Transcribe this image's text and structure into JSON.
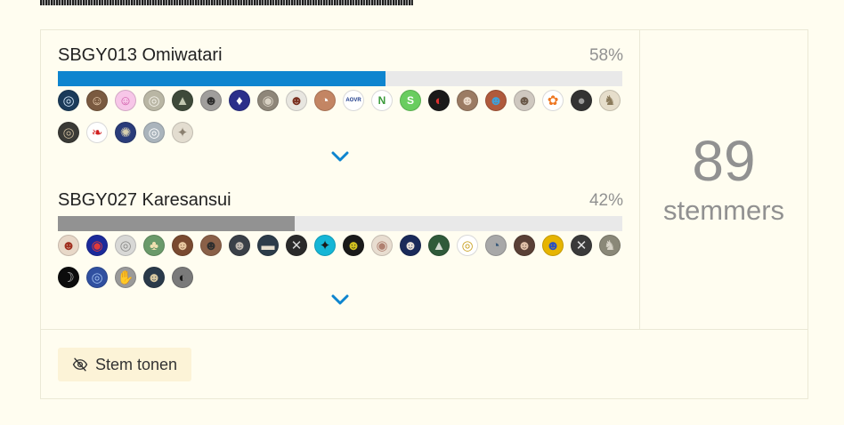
{
  "poll": {
    "options": [
      {
        "name": "SBGY013 Omiwatari",
        "percent_label": "58%",
        "percent": 58,
        "bar_color": "#0e85cf",
        "voters": [
          {
            "bg": "#1b3b5a",
            "fg": "#cfe3f5",
            "glyph": "◎"
          },
          {
            "bg": "#7a5a40",
            "fg": "#f3d8b8",
            "glyph": "☺"
          },
          {
            "bg": "#f7c6e8",
            "fg": "#d05aa8",
            "glyph": "☺"
          },
          {
            "bg": "#b9b6a4",
            "fg": "#f4f2ea",
            "glyph": "◎"
          },
          {
            "bg": "#3e4a3a",
            "fg": "#c0c7b0",
            "glyph": "▲"
          },
          {
            "bg": "#a09e9c",
            "fg": "#2e2e2e",
            "glyph": "☻"
          },
          {
            "bg": "#2b2f8a",
            "fg": "#ffffff",
            "glyph": "♦"
          },
          {
            "bg": "#8e8679",
            "fg": "#d9d2c4",
            "glyph": "◉"
          },
          {
            "bg": "#e8e6e0",
            "fg": "#7a3020",
            "glyph": "☻"
          },
          {
            "bg": "#c38563",
            "fg": "#ffffff",
            "glyph": "◔"
          },
          {
            "bg": "#ffffff",
            "fg": "#1c3a8a",
            "glyph": "AOVR"
          },
          {
            "bg": "#ffffff",
            "fg": "#3a9a3a",
            "glyph": "N"
          },
          {
            "bg": "#69cd5f",
            "fg": "#ffffff",
            "glyph": "S"
          },
          {
            "bg": "#1a1a1a",
            "fg": "#e03030",
            "glyph": "◐"
          },
          {
            "bg": "#9b7b63",
            "fg": "#e9d8c8",
            "glyph": "☻"
          },
          {
            "bg": "#b05a3c",
            "fg": "#3fa0d8",
            "glyph": "☻"
          },
          {
            "bg": "#cfc8c0",
            "fg": "#6a5848",
            "glyph": "☻"
          },
          {
            "bg": "#ffffff",
            "fg": "#ee7722",
            "glyph": "✿"
          },
          {
            "bg": "#333333",
            "fg": "#9a9a9a",
            "glyph": "●"
          },
          {
            "bg": "#e6decb",
            "fg": "#8a7a5a",
            "glyph": "♞"
          },
          {
            "bg": "#3a3a36",
            "fg": "#c8b89a",
            "glyph": "◎"
          },
          {
            "bg": "#ffffff",
            "fg": "#d02020",
            "glyph": "❧"
          },
          {
            "bg": "#2a3c7a",
            "fg": "#d8d0b0",
            "glyph": "✺"
          },
          {
            "bg": "#aab4bc",
            "fg": "#ffffff",
            "glyph": "◎"
          },
          {
            "bg": "#e3ddd0",
            "fg": "#8a8070",
            "glyph": "✦"
          }
        ]
      },
      {
        "name": "SBGY027 Karesansui",
        "percent_label": "42%",
        "percent": 42,
        "bar_color": "#929292",
        "voters": [
          {
            "bg": "#e8d8c8",
            "fg": "#a03020",
            "glyph": "☻"
          },
          {
            "bg": "#1b2a9a",
            "fg": "#e03a3a",
            "glyph": "◉"
          },
          {
            "bg": "#d8d8d6",
            "fg": "#8a8a88",
            "glyph": "◎"
          },
          {
            "bg": "#6a9a6a",
            "fg": "#f0e0b0",
            "glyph": "♣"
          },
          {
            "bg": "#7a4a30",
            "fg": "#e8c8a0",
            "glyph": "☻"
          },
          {
            "bg": "#8a6048",
            "fg": "#2e2e2e",
            "glyph": "☻"
          },
          {
            "bg": "#3a4048",
            "fg": "#c0b8b0",
            "glyph": "☻"
          },
          {
            "bg": "#2c3c4a",
            "fg": "#e8e0d0",
            "glyph": "▬"
          },
          {
            "bg": "#2a2a2a",
            "fg": "#d8d8d8",
            "glyph": "✕"
          },
          {
            "bg": "#15b6d6",
            "fg": "#1a1a1a",
            "glyph": "✦"
          },
          {
            "bg": "#1a1a1a",
            "fg": "#d0c020",
            "glyph": "☻"
          },
          {
            "bg": "#e8ddd0",
            "fg": "#b08070",
            "glyph": "◉"
          },
          {
            "bg": "#1a2a5a",
            "fg": "#e8e0d8",
            "glyph": "☻"
          },
          {
            "bg": "#2f5a3a",
            "fg": "#d0d8d0",
            "glyph": "▲"
          },
          {
            "bg": "#ffffff",
            "fg": "#c8a020",
            "glyph": "◎"
          },
          {
            "bg": "#a8a8a8",
            "fg": "#3a5a7a",
            "glyph": "◔"
          },
          {
            "bg": "#5a4036",
            "fg": "#e0c0a8",
            "glyph": "☻"
          },
          {
            "bg": "#e6b400",
            "fg": "#2a50c0",
            "glyph": "☻"
          },
          {
            "bg": "#3a3a3a",
            "fg": "#e0e0e0",
            "glyph": "✕"
          },
          {
            "bg": "#8a8878",
            "fg": "#d8d4c8",
            "glyph": "♞"
          },
          {
            "bg": "#0c0c0c",
            "fg": "#c8c8c8",
            "glyph": "☽"
          },
          {
            "bg": "#3050a0",
            "fg": "#a0c0f0",
            "glyph": "◎"
          },
          {
            "bg": "#9a9a9a",
            "fg": "#ffffff",
            "glyph": "✋"
          },
          {
            "bg": "#2a3a4a",
            "fg": "#d8c8a0",
            "glyph": "☻"
          },
          {
            "bg": "#7a7a7a",
            "fg": "#1a1a1a",
            "glyph": "◐"
          }
        ]
      }
    ],
    "voter_count": "89",
    "voter_label": "stemmers",
    "show_vote_label": "Stem tonen",
    "accent_color": "#0e85cf",
    "icons": {
      "expand": "chevron-down-icon",
      "show_vote": "eye-off-icon"
    }
  }
}
